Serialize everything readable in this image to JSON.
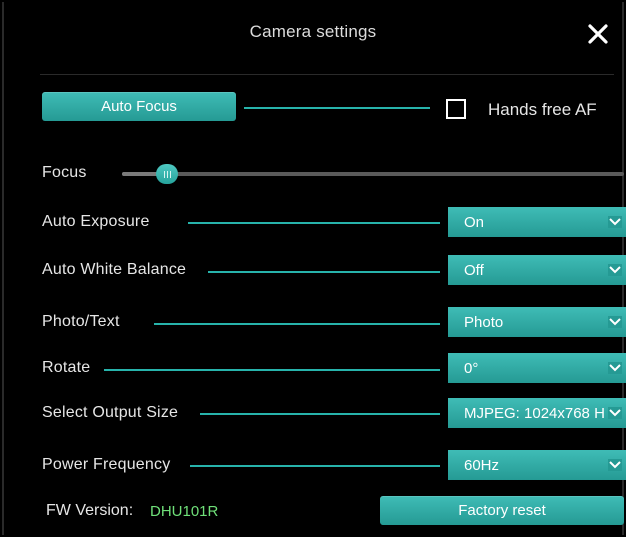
{
  "dialog": {
    "title": "Camera settings",
    "close_icon": "close-icon"
  },
  "auto_focus": {
    "button_label": "Auto Focus",
    "hands_free_label": "Hands free AF",
    "hands_free_checked": false
  },
  "focus": {
    "label": "Focus",
    "level": 0.09
  },
  "settings": [
    {
      "label": "Auto Exposure",
      "value": "On"
    },
    {
      "label": "Auto White Balance",
      "value": "Off"
    },
    {
      "label": "Photo/Text",
      "value": "Photo"
    },
    {
      "label": "Rotate",
      "value": "0°"
    },
    {
      "label": "Select Output Size",
      "value": "MJPEG: 1024x768 H"
    },
    {
      "label": "Power Frequency",
      "value": "60Hz"
    }
  ],
  "footer": {
    "fw_label": "FW Version:",
    "fw_value": "DHU101R",
    "factory_reset_label": "Factory reset"
  },
  "colors": {
    "accent": "#2fb0a9",
    "accent_line": "#27b3ab",
    "version_text": "#6fe079",
    "background": "#000000"
  }
}
